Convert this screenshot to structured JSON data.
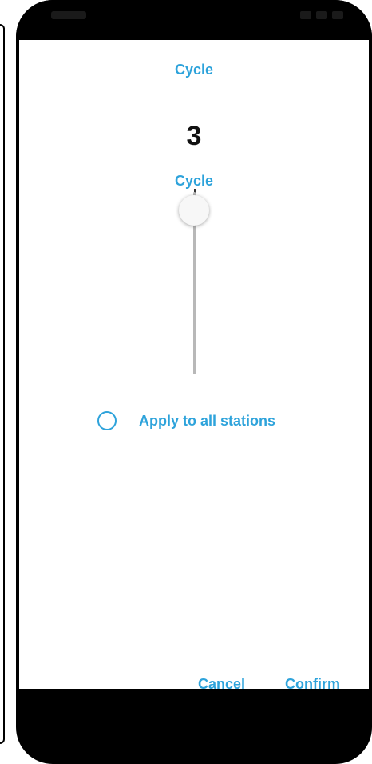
{
  "dialog": {
    "title": "Cycle",
    "value": "3",
    "unit": "Cycle",
    "slider": {
      "min_label": "",
      "current": 3
    },
    "apply_all": {
      "label": "Apply to all stations",
      "checked": false
    },
    "buttons": {
      "cancel": "Cancel",
      "confirm": "Confirm"
    }
  },
  "colors": {
    "accent": "#2ea3db",
    "value_text": "#111111",
    "track": "#b8b8b8",
    "background": "#ffffff",
    "frame": "#000000"
  }
}
